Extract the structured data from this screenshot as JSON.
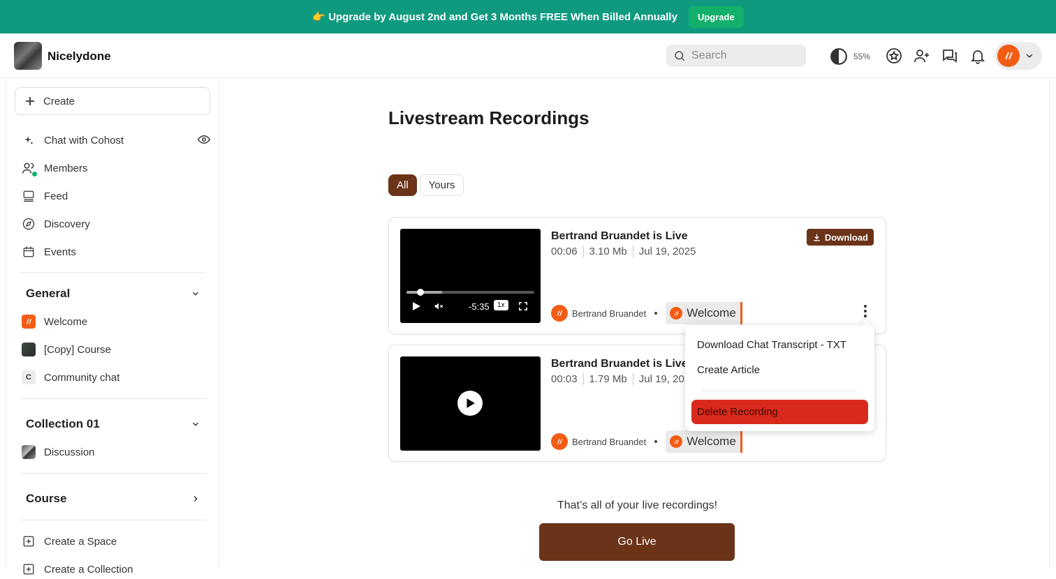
{
  "banner": {
    "emoji": "👉",
    "text": "Upgrade by August 2nd and Get 3 Months FREE When Billed Annually",
    "button_label": "Upgrade"
  },
  "header": {
    "brand": "Nicelydone",
    "search_placeholder": "Search",
    "contrast_value": "55%"
  },
  "sidebar": {
    "create_label": "Create",
    "nav": [
      {
        "label": "Chat with Cohost",
        "icon": "sparkle-icon"
      },
      {
        "label": "Members",
        "icon": "members-icon"
      },
      {
        "label": "Feed",
        "icon": "feed-icon"
      },
      {
        "label": "Discovery",
        "icon": "compass-icon"
      },
      {
        "label": "Events",
        "icon": "calendar-icon"
      }
    ],
    "sections": [
      {
        "title": "General",
        "items": [
          "Welcome",
          "[Copy] Course",
          "Community chat"
        ]
      },
      {
        "title": "Collection 01",
        "items": [
          "Discussion"
        ]
      },
      {
        "title": "Course",
        "items": []
      }
    ],
    "community_chat_initial": "C",
    "create_space_label": "Create a Space",
    "create_collection_label": "Create a Collection"
  },
  "main": {
    "title": "Livestream Recordings",
    "tabs": [
      "All",
      "Yours"
    ],
    "recordings": [
      {
        "title": "Bertrand Bruandet is Live",
        "duration": "00:06",
        "size": "3.10 Mb",
        "date": "Jul 19, 2025",
        "owner": "Bertrand Bruandet",
        "space": "Welcome",
        "player_time": "-5:35",
        "player_speed": "1x"
      },
      {
        "title": "Bertrand Bruandet is Live",
        "duration": "00:03",
        "size": "1.79 Mb",
        "date": "Jul 19, 2025",
        "owner": "Bertrand Bruandet",
        "space": "Welcome"
      }
    ],
    "download_label": "Download",
    "menu": {
      "download_transcript": "Download Chat Transcript - TXT",
      "create_article": "Create Article",
      "delete": "Delete Recording"
    },
    "end_text": "That’s all of your live recordings!",
    "go_live_label": "Go Live"
  },
  "colors": {
    "banner": "#0f9a80",
    "brand_brown": "#6b3318",
    "accent_orange": "#f25c14",
    "danger": "#d9291c"
  }
}
